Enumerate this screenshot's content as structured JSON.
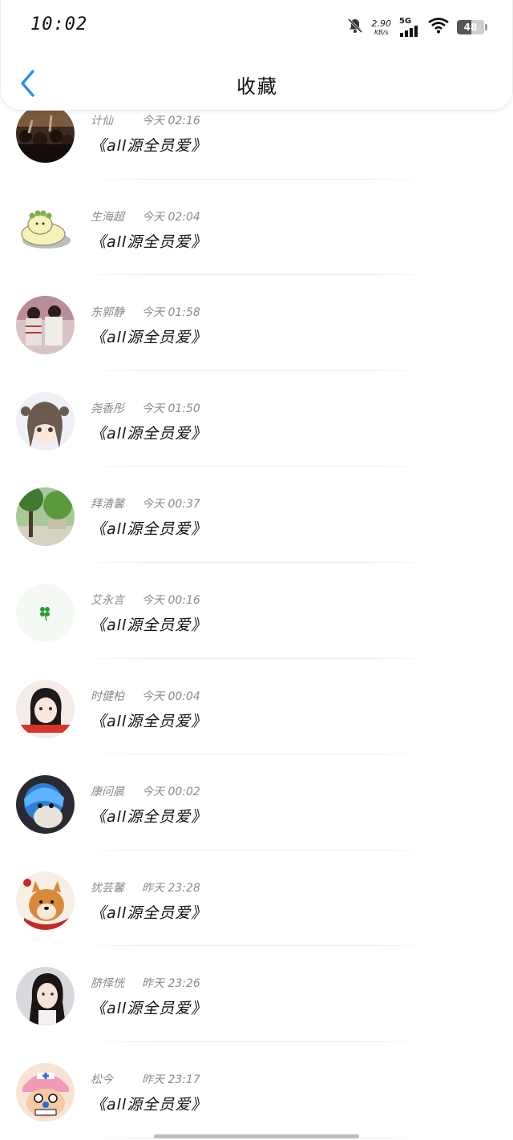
{
  "status_bar": {
    "time": "10:02",
    "net_speed_value": "2.90",
    "net_speed_unit": "KB/s",
    "network_type": "5G",
    "battery_level": "48"
  },
  "header": {
    "title": "收藏"
  },
  "items": [
    {
      "name": "计仙",
      "time": "今天 02:16",
      "message": "《all源全员爱》",
      "avatar": "crowd-photo"
    },
    {
      "name": "生海超",
      "time": "今天 02:04",
      "message": "《all源全员爱》",
      "avatar": "cartoon-blob"
    },
    {
      "name": "东郭静",
      "time": "今天 01:58",
      "message": "《all源全员爱》",
      "avatar": "friends-photo"
    },
    {
      "name": "尧香彤",
      "time": "今天 01:50",
      "message": "《all源全员爱》",
      "avatar": "anime-girl"
    },
    {
      "name": "拜清馨",
      "time": "今天 00:37",
      "message": "《all源全员爱》",
      "avatar": "park-trees"
    },
    {
      "name": "艾永言",
      "time": "今天 00:16",
      "message": "《all源全员爱》",
      "avatar": "four-leaf-clover"
    },
    {
      "name": "时健柏",
      "time": "今天 00:04",
      "message": "《all源全员爱》",
      "avatar": "girl-selfie"
    },
    {
      "name": "康问晨",
      "time": "今天 00:02",
      "message": "《all源全员爱》",
      "avatar": "blue-hair-figure"
    },
    {
      "name": "犹芸馨",
      "time": "昨天 23:28",
      "message": "《all源全员爱》",
      "avatar": "shiba-dog"
    },
    {
      "name": "脐怿恍",
      "time": "昨天 23:26",
      "message": "《all源全员爱》",
      "avatar": "girl-portrait"
    },
    {
      "name": "松今",
      "time": "昨天 23:17",
      "message": "《all源全员爱》",
      "avatar": "chopper-cartoon"
    }
  ],
  "colors": {
    "accent": "#2b8ef0",
    "meta_text": "#8a8a8a",
    "divider": "#ececec"
  }
}
